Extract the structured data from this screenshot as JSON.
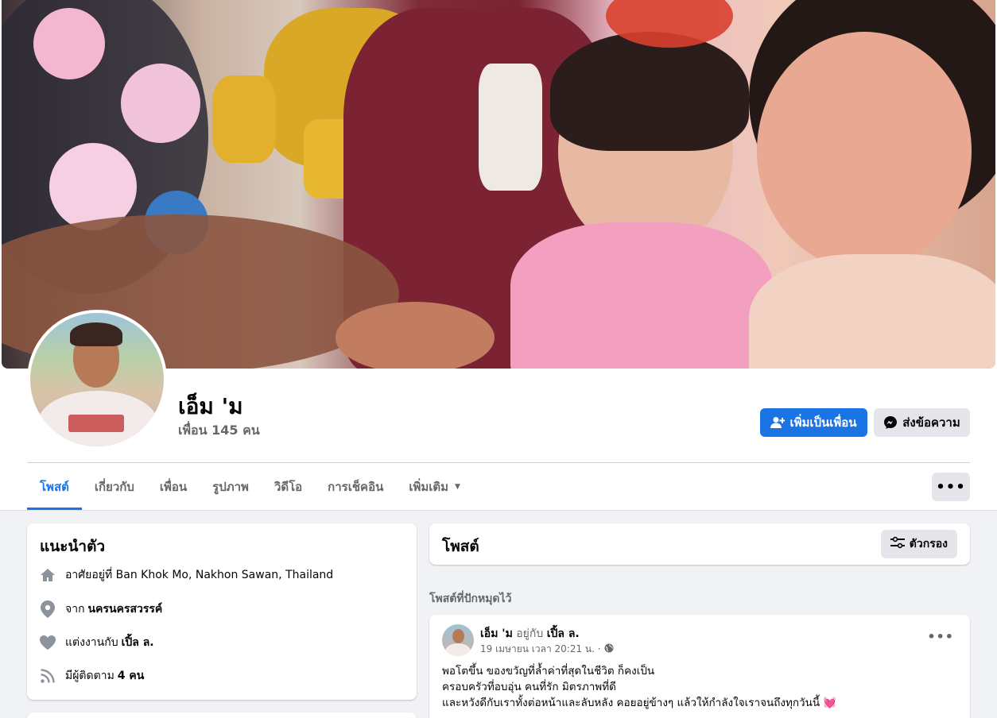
{
  "profile": {
    "name": "เอ็ม 'ม",
    "friends": "เพื่อน 145 คน"
  },
  "actions": {
    "add_friend": "เพิ่มเป็นเพื่อน",
    "message": "ส่งข้อความ"
  },
  "tabs": [
    {
      "label": "โพสต์",
      "active": true
    },
    {
      "label": "เกี่ยวกับ"
    },
    {
      "label": "เพื่อน"
    },
    {
      "label": "รูปภาพ"
    },
    {
      "label": "วิดีโอ"
    },
    {
      "label": "การเช็คอิน"
    },
    {
      "label": "เพิ่มเติม"
    }
  ],
  "intro": {
    "title": "แนะนำตัว",
    "lives_in": "อาศัยอยู่ที่ Ban Khok Mo, Nakhon Sawan, Thailand",
    "from_prefix": "จาก",
    "from_place": "นครนครสวรรค์",
    "married_prefix": "แต่งงานกับ",
    "married_to": "เปิ้ล ล.",
    "followers_prefix": "มีผู้ติดตาม",
    "followers_count": "4 คน"
  },
  "posts": {
    "title": "โพสต์",
    "filter": "ตัวกรอง",
    "pinned_label": "โพสต์ที่ปักหมุดไว้"
  },
  "pinned_post": {
    "author": "เอ็ม 'ม",
    "with_word": "อยู่กับ",
    "tagged": "เปิ้ล ล.",
    "timestamp": "19 เมษายน เวลา 20:21 น. ·",
    "lines": [
      "พอโตขึ้น  ของขวัญที่ล้ำค่าที่สุดในชีวิต ก็คงเป็น",
      "ครอบครัวที่อบอุ่น คนที่รัก  มิตรภาพที่ดี",
      "และหวังดีกับเราทั้งต่อหน้าและลับหลัง  คอยอยู่ข้างๆ แล้วให้กำลังใจเราจนถึงทุกวันนี้ 💓"
    ]
  },
  "colors": {
    "accent": "#1b74e4",
    "page_bg": "#f0f2f5",
    "secondary_text": "#65676b"
  },
  "icons": [
    "add-friend-icon",
    "messenger-icon",
    "chevron-down-icon",
    "more-icon",
    "filter-icon",
    "home-icon",
    "location-pin-icon",
    "heart-icon",
    "rss-icon",
    "globe-icon"
  ]
}
